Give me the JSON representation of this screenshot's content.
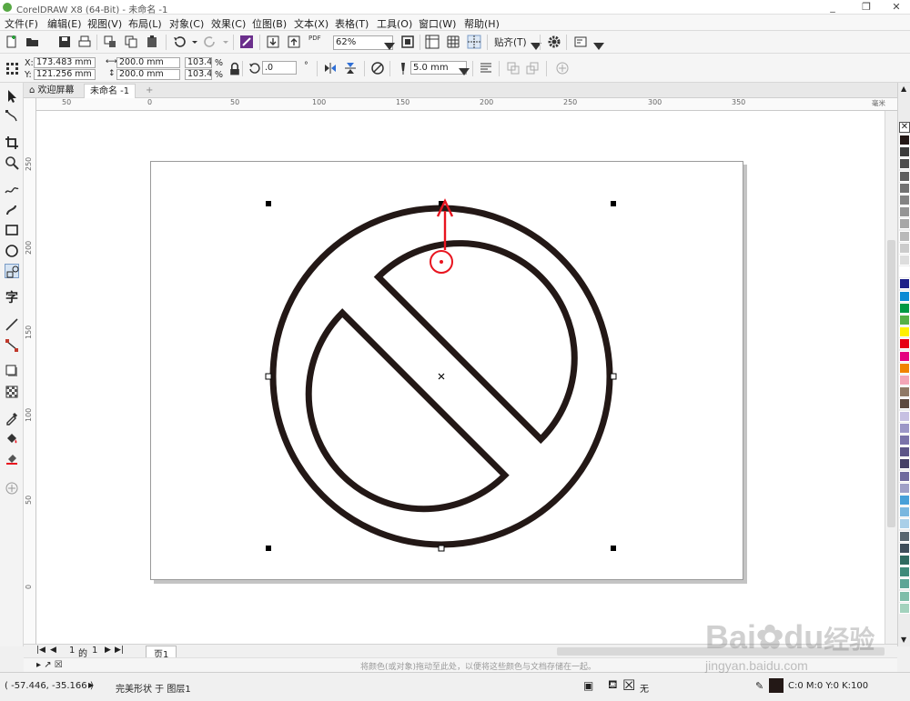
{
  "window": {
    "title": "CorelDRAW X8 (64-Bit) - 未命名 -1",
    "controls": [
      "_",
      "❐",
      "✕"
    ]
  },
  "menu": {
    "items": [
      "文件(F)",
      "编辑(E)",
      "视图(V)",
      "布局(L)",
      "对象(C)",
      "效果(C)",
      "位图(B)",
      "文本(X)",
      "表格(T)",
      "工具(O)",
      "窗口(W)",
      "帮助(H)"
    ]
  },
  "standard_toolbar": {
    "zoom_value": "62%",
    "snap_label": "贴齐(T)",
    "pdf_label": "PDF"
  },
  "property_bar": {
    "x_label": "X:",
    "x_value": "173.483 mm",
    "y_label": "Y:",
    "y_value": "121.256 mm",
    "width_value": "200.0 mm",
    "height_value": "200.0 mm",
    "scale_x": "103.4",
    "scale_y": "103.4",
    "percent": "%",
    "rotation": ".0",
    "degree": "°",
    "outline_width": "5.0 mm"
  },
  "doc_tabs": {
    "welcome": "欢迎屏幕",
    "document": "未命名 -1",
    "add": "+"
  },
  "ruler": {
    "h_labels": [
      "50",
      "0",
      "50",
      "100",
      "150",
      "200",
      "250",
      "300",
      "350"
    ],
    "unit": "毫米",
    "v_labels": [
      "250",
      "200",
      "150",
      "100",
      "50",
      "0"
    ]
  },
  "page_nav": {
    "current": "1",
    "of": "的",
    "total": "1",
    "page_tab": "页1"
  },
  "drop_hint": "将颜色(或对象)拖动至此处，以便将这些颜色与文档存储在一起。",
  "status": {
    "coords": "( -57.446, -35.166 )",
    "arrow": "▶",
    "object_info": "完美形状 于 图层1",
    "fill_label": "无",
    "outline_color": "#231816",
    "outline_info": "C:0 M:0 Y:0 K:100"
  },
  "watermark": {
    "brand": "Bai",
    "brand2": "du",
    "cn": "经验",
    "url": "jingyan.baidu.com"
  },
  "colors": {
    "shape_stroke": "#231816",
    "annotation_red": "#e8141f",
    "accent_tab": "#ffffff"
  },
  "palette": [
    "#231816",
    "#3b3b3b",
    "#4d4d4d",
    "#5f5f5f",
    "#717171",
    "#838383",
    "#959595",
    "#a7a7a7",
    "#b9b9b9",
    "#cbcbcb",
    "#dddddd",
    "#ffffff",
    "#1d2088",
    "#0b8ad4",
    "#009944",
    "#56b046",
    "#fff100",
    "#e60012",
    "#e4007f",
    "#f08300",
    "#f3a6b7",
    "#8f7966",
    "#5d4a3f",
    "#c7c0e2",
    "#9c97c7",
    "#7a73a9",
    "#5c5587",
    "#454066",
    "#6f6a9e",
    "#9fa0c7",
    "#48a0d8",
    "#7ab7df",
    "#a9cfe8",
    "#596770",
    "#3e4e5a",
    "#2f6a60",
    "#3f8a7a",
    "#5ca596",
    "#7fbda9",
    "#a3d2bd"
  ]
}
